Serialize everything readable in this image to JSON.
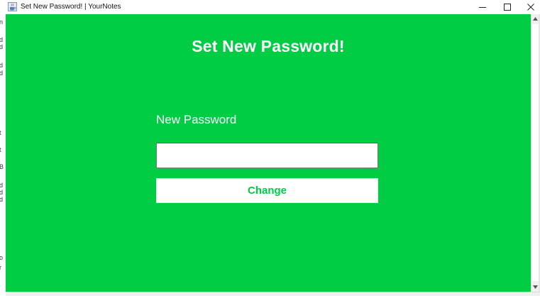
{
  "window": {
    "title": "Set New Password! | YourNotes",
    "icon": "java-cup-icon",
    "minimize_symbol": "—",
    "maximize_symbol": "☐",
    "close_symbol": "✕"
  },
  "colors": {
    "background": "#00cc44",
    "text_on_background": "#ffffff",
    "button_background": "#ffffff",
    "button_text": "#00cc44"
  },
  "form": {
    "heading": "Set New Password!",
    "new_password_label": "New Password",
    "new_password_value": "",
    "change_button_label": "Change"
  }
}
